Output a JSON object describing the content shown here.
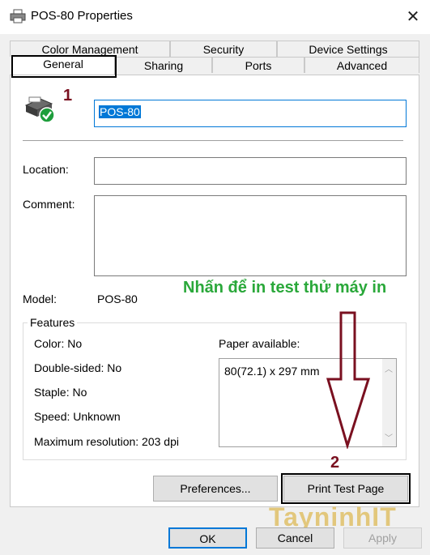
{
  "window": {
    "title": "POS-80 Properties"
  },
  "tabs_row1": [
    {
      "label": "Color Management"
    },
    {
      "label": "Security"
    },
    {
      "label": "Device Settings"
    }
  ],
  "tabs_row2": [
    {
      "label": "General"
    },
    {
      "label": "Sharing"
    },
    {
      "label": "Ports"
    },
    {
      "label": "Advanced"
    }
  ],
  "general": {
    "printer_name": "POS-80",
    "location_label": "Location:",
    "location_value": "",
    "comment_label": "Comment:",
    "comment_value": "",
    "model_label": "Model:",
    "model_value": "POS-80"
  },
  "features": {
    "group_label": "Features",
    "color": "Color: No",
    "double_sided": "Double-sided: No",
    "staple": "Staple: No",
    "speed": "Speed: Unknown",
    "max_resolution": "Maximum resolution: 203 dpi",
    "paper_label": "Paper available:",
    "paper_items": [
      "80(72.1) x 297 mm"
    ]
  },
  "buttons": {
    "preferences": "Preferences...",
    "print_test_page": "Print Test Page",
    "ok": "OK",
    "cancel": "Cancel",
    "apply": "Apply"
  },
  "annotations": {
    "step1": "1",
    "step2": "2",
    "instruction": "Nhấn để in test thử máy in",
    "watermark": "TayninhIT"
  },
  "colors": {
    "annotation_red": "#7a1020",
    "instruction_green": "#2aa83a",
    "selection_blue": "#0078d7",
    "ok_border": "#0078d7"
  }
}
